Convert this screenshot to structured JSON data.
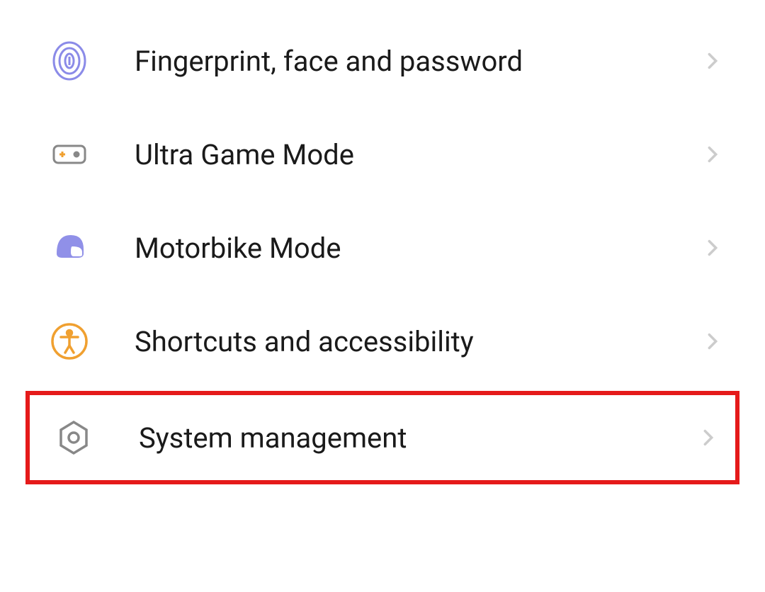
{
  "settings": {
    "items": [
      {
        "label": "Fingerprint, face and password",
        "icon": "fingerprint-icon",
        "highlighted": false
      },
      {
        "label": "Ultra Game Mode",
        "icon": "gamepad-icon",
        "highlighted": false
      },
      {
        "label": "Motorbike Mode",
        "icon": "helmet-icon",
        "highlighted": false
      },
      {
        "label": "Shortcuts and accessibility",
        "icon": "accessibility-icon",
        "highlighted": false
      },
      {
        "label": "System management",
        "icon": "system-icon",
        "highlighted": true
      }
    ]
  },
  "colors": {
    "purple": "#8b8be8",
    "orange": "#f0a030",
    "gray": "#888888",
    "highlight": "#e51a1a"
  }
}
